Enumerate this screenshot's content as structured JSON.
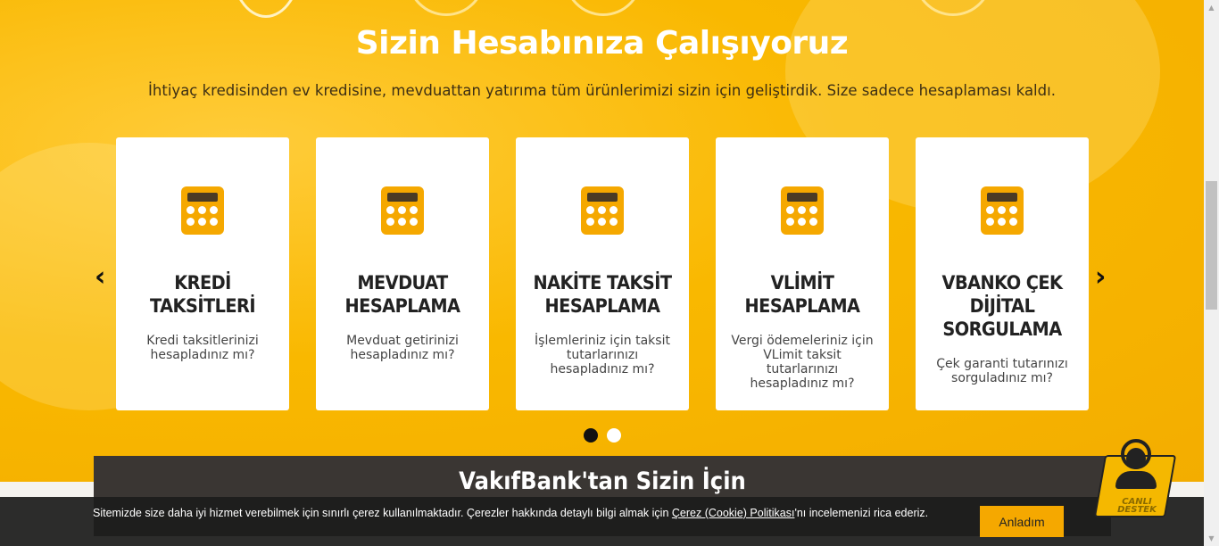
{
  "hero": {
    "title": "Sizin Hesabınıza Çalışıyoruz",
    "subtitle": "İhtiyaç kredisinden ev kredisine, mevduattan yatırıma tüm ürünlerimizi sizin için geliştirdik. Size sadece hesaplaması kaldı."
  },
  "carousel": {
    "prev_icon": "chevron-left-icon",
    "next_icon": "chevron-right-icon",
    "prev_label": "‹",
    "next_label": "›",
    "active_page": 1,
    "page_count": 2,
    "cards": [
      {
        "title": "KREDİ TAKSİTLERİ",
        "desc": "Kredi taksitlerinizi hesapladınız mı?",
        "icon": "calculator-icon"
      },
      {
        "title": "MEVDUAT HESAPLAMA",
        "desc": "Mevduat getirinizi hesapladınız mı?",
        "icon": "calculator-icon"
      },
      {
        "title": "NAKİTE TAKSİT HESAPLAMA",
        "desc": "İşlemleriniz için taksit tutarlarınızı hesapladınız mı?",
        "icon": "calculator-icon"
      },
      {
        "title": "VLİMİT HESAPLAMA",
        "desc": "Vergi ödemeleriniz için VLimit taksit tutarlarınızı hesapladınız mı?",
        "icon": "calculator-icon"
      },
      {
        "title": "VBANKO ÇEK DİJİTAL SORGULAMA",
        "desc": "Çek garanti tutarınızı sorguladınız mı?",
        "icon": "calculator-icon"
      }
    ]
  },
  "section": {
    "title": "VakıfBank'tan Sizin İçin"
  },
  "cookie": {
    "text_before": "Sitemizde size daha iyi hizmet verebilmek için sınırlı çerez kullanılmaktadır. Çerezler hakkında detaylı bilgi almak için ",
    "link": "Çerez (Cookie) Politikası",
    "text_after": "'nı incelemenizi rica ederiz.",
    "accept_label": "Anladım"
  },
  "support": {
    "label": "CANLI DESTEK",
    "icon": "headset-agent-icon"
  },
  "colors": {
    "accent": "#f5a800",
    "hero_bg": "#f9b800",
    "dark_panel": "#3a3633"
  }
}
